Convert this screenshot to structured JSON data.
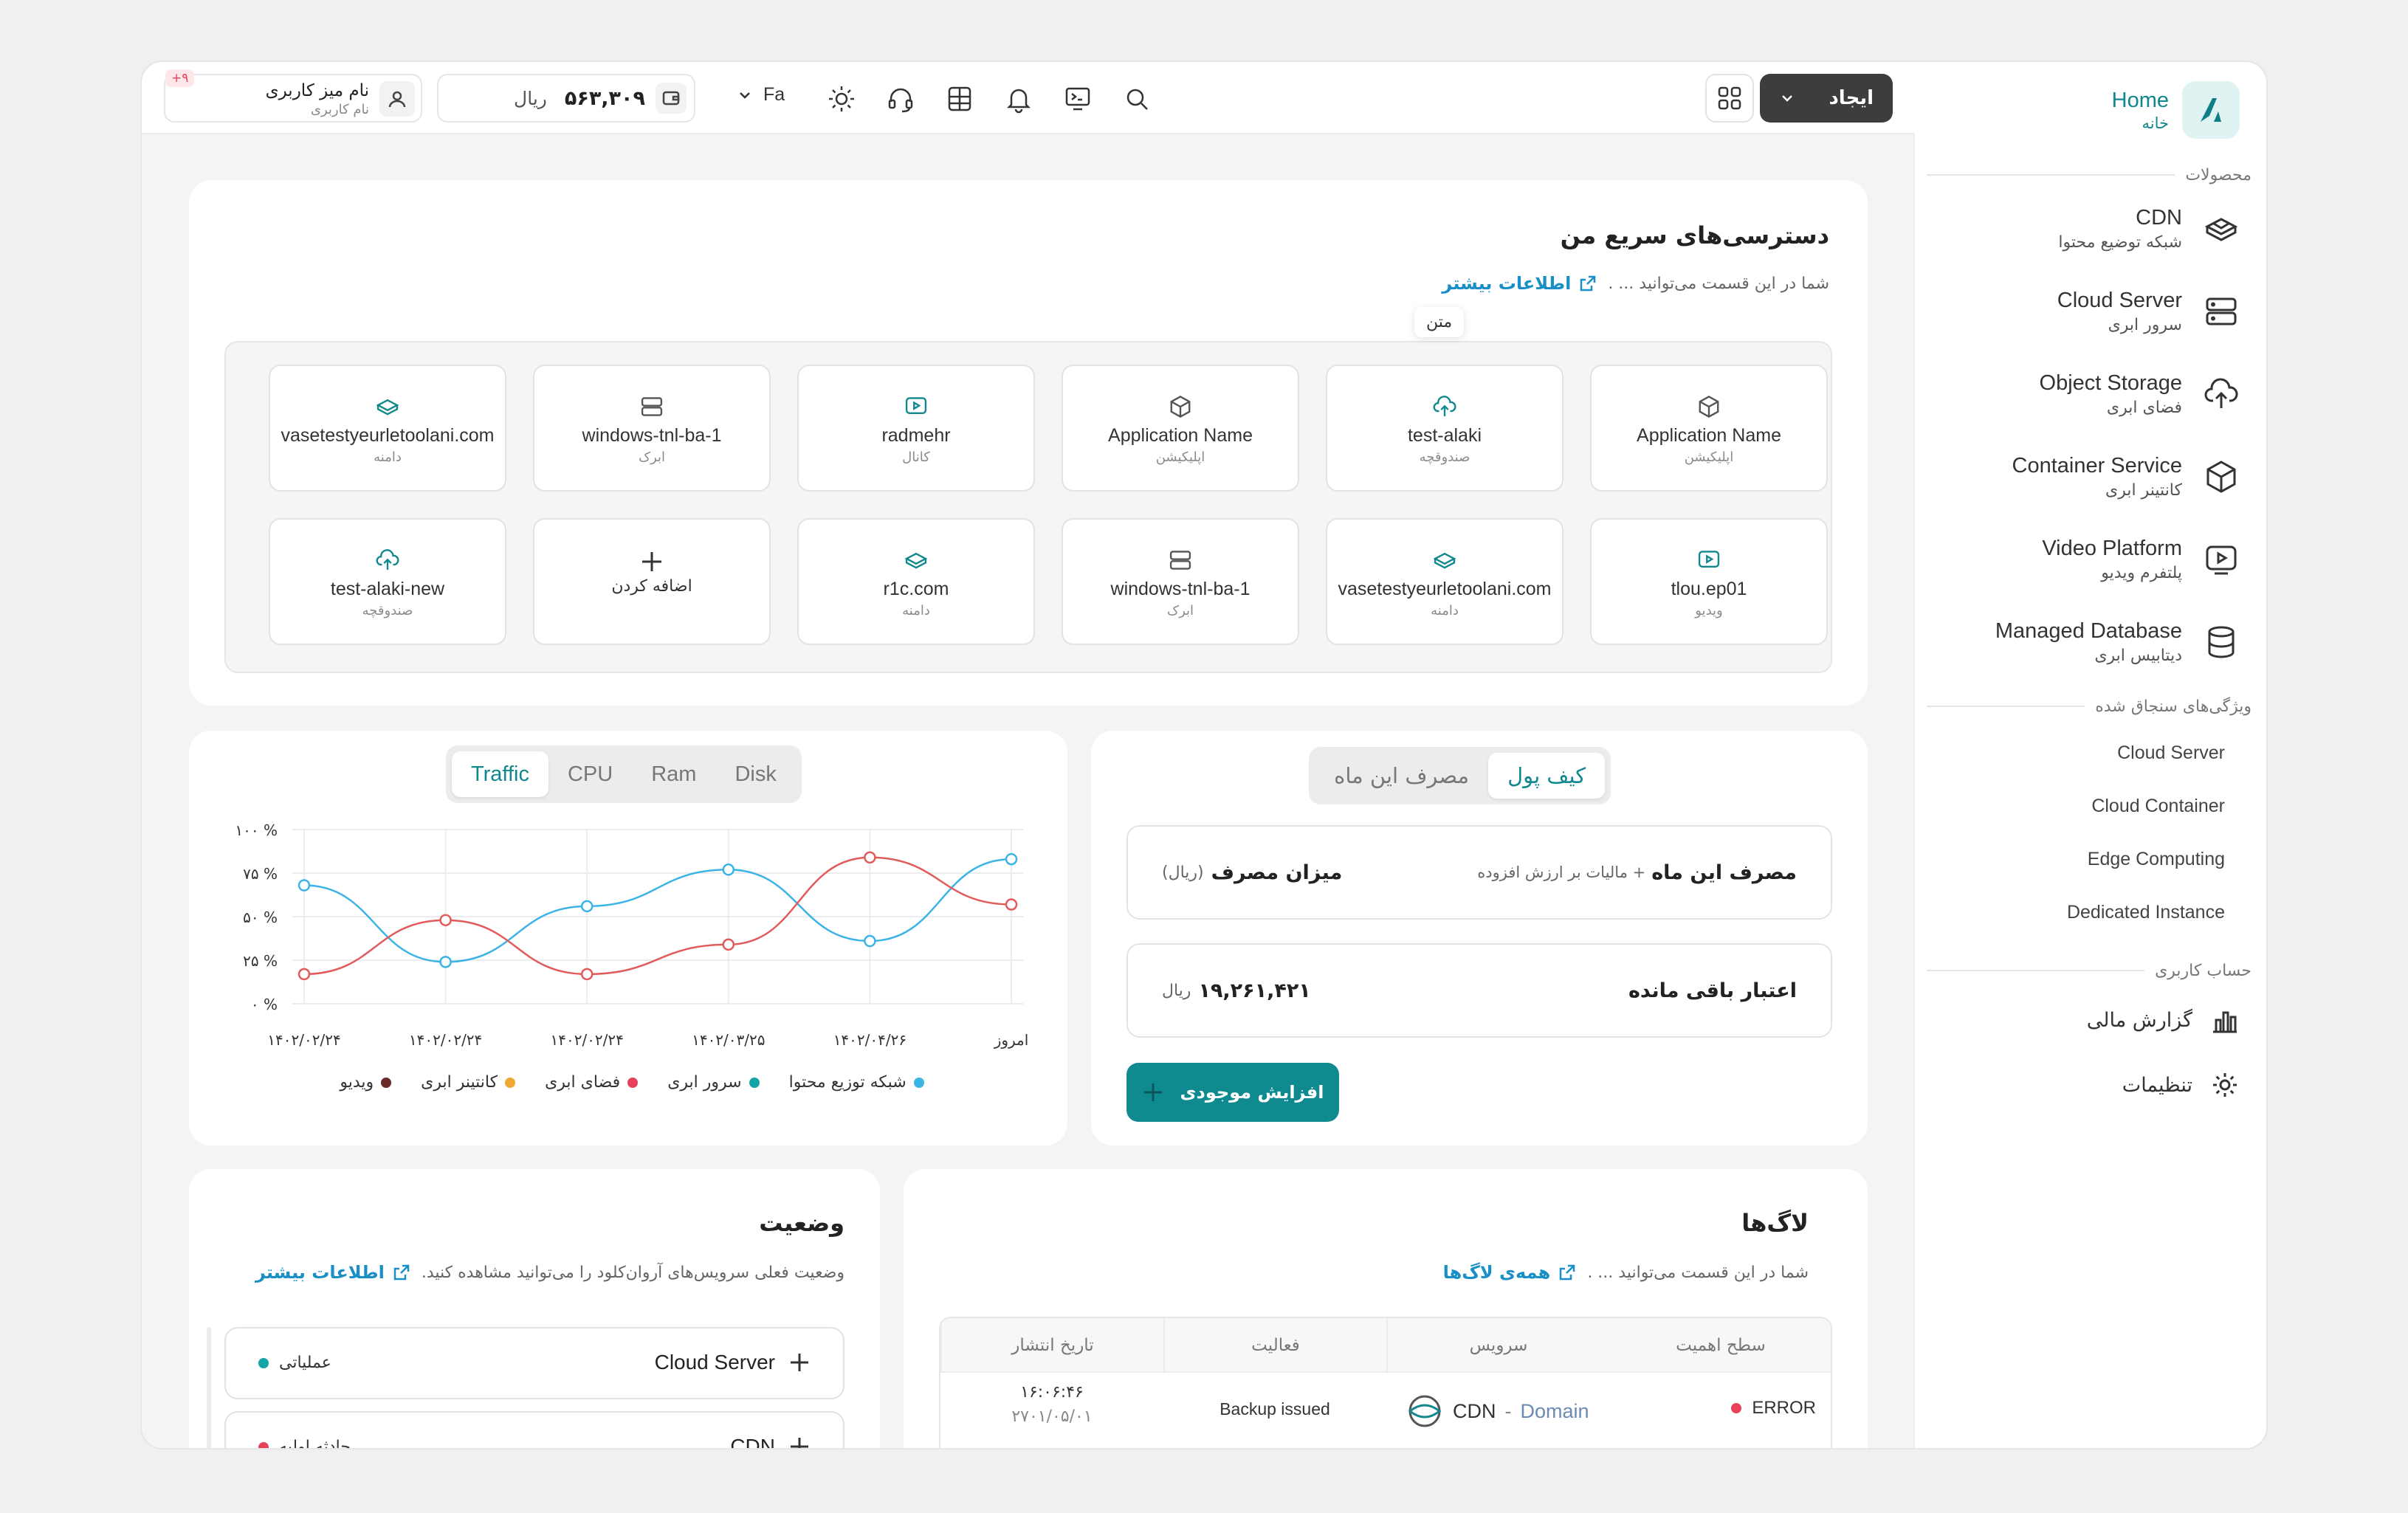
{
  "sidebar": {
    "logo_en": "Home",
    "logo_fa": "خانه",
    "products_label": "محصولات",
    "products": [
      {
        "en": "CDN",
        "fa": "شبکه توضیع محتوا",
        "icon": "cdn-icon"
      },
      {
        "en": "Cloud Server",
        "fa": "سرور ابری",
        "icon": "server-icon"
      },
      {
        "en": "Object Storage",
        "fa": "فضای ابری",
        "icon": "cloud-upload-icon"
      },
      {
        "en": "Container Service",
        "fa": "کانتینر ابری",
        "icon": "box-icon"
      },
      {
        "en": "Video Platform",
        "fa": "پلتفرم ویدیو",
        "icon": "video-icon"
      },
      {
        "en": "Managed Database",
        "fa": "دیتابیس ابری",
        "icon": "database-icon"
      }
    ],
    "features_label": "ویژگی‌های سنجاق شده",
    "features": [
      "Cloud Server",
      "Cloud Container",
      "Edge Computing",
      "Dedicated Instance"
    ],
    "account_label": "حساب کاربری",
    "account": [
      {
        "label": "گزارش مالی",
        "icon": "bar-chart-icon"
      },
      {
        "label": "تنظیمات",
        "icon": "gear-icon"
      }
    ]
  },
  "header": {
    "create_label": "ایجاد",
    "language": "Fa",
    "wallet_amount": "۵۶۳,۳۰۹",
    "wallet_unit": "ریال",
    "user_name": "نام میز کاربری",
    "user_sub": "نام کاربری",
    "badge": "+۹"
  },
  "quick_access": {
    "title": "دسترسی‌های سریع من",
    "desc": "شما در این قسمت می‌توانید ... .",
    "more": "اطلاعات بیشتر",
    "tooltip": "متن",
    "row1": [
      {
        "name": "Application Name",
        "sub": "اپلیکیشن",
        "icon": "box-icon"
      },
      {
        "name": "test-alaki",
        "sub": "صندوقچه",
        "icon": "cloud-upload-icon"
      },
      {
        "name": "Application Name",
        "sub": "اپلیکیشن",
        "icon": "box-icon"
      },
      {
        "name": "radmehr",
        "sub": "کانال",
        "icon": "video-icon"
      },
      {
        "name": "windows-tnl-ba-1",
        "sub": "ابرک",
        "icon": "server-icon"
      },
      {
        "name": "vasetestyeurletoolani.com",
        "sub": "دامنه",
        "icon": "cdn-icon"
      }
    ],
    "row2": [
      {
        "name": "tlou.ep01",
        "sub": "ویدیو",
        "icon": "video-icon"
      },
      {
        "name": "vasetestyeurletoolani.com",
        "sub": "دامنه",
        "icon": "cdn-icon"
      },
      {
        "name": "windows-tnl-ba-1",
        "sub": "ابرک",
        "icon": "server-icon"
      },
      {
        "name": "r1c.com",
        "sub": "دامنه",
        "icon": "cdn-icon"
      },
      {
        "name": "",
        "sub": "اضافه کردن",
        "icon": "plus-icon"
      },
      {
        "name": "test-alaki-new",
        "sub": "صندوقچه",
        "icon": "cloud-upload-icon"
      }
    ]
  },
  "wallet_card": {
    "tabs": [
      "کیف پول",
      "مصرف این ماه"
    ],
    "usage_title": "مصرف این ماه",
    "usage_note": "+ مالیات بر ارزش افزوده",
    "usage_amount_label": "میزان مصرف",
    "usage_amount_unit": "(ریال)",
    "credit_label": "اعتبار باقی مانده",
    "credit_value": "۱۹,۲۶۱,۴۲۱",
    "credit_unit": "ریال",
    "add_button": "افزایش موجودی"
  },
  "chart_card": {
    "tabs": [
      "Traffic",
      "CPU",
      "Ram",
      "Disk"
    ],
    "active_tab": "Traffic"
  },
  "chart_data": {
    "type": "line",
    "categories": [
      "۱۴۰۲/۰۲/۲۴",
      "۱۴۰۲/۰۲/۲۴",
      "۱۴۰۲/۰۲/۲۴",
      "۱۴۰۲/۰۳/۲۵",
      "۱۴۰۲/۰۴/۲۶",
      "امروز"
    ],
    "y_ticks": [
      "۰ %",
      "۲۵ %",
      "۵۰ %",
      "۷۵ %",
      "۱۰۰ %"
    ],
    "ylim": [
      0,
      100
    ],
    "series": [
      {
        "name": "شبکه توزیع محتوا",
        "color": "#3bb4e5",
        "values": [
          68,
          24,
          56,
          77,
          36,
          83
        ]
      },
      {
        "name": "سرور ابری",
        "color": "#e25b5b",
        "values": [
          17,
          48,
          17,
          34,
          84,
          57
        ]
      }
    ],
    "legend": [
      {
        "name": "شبکه توزیع محتوا",
        "color": "#3bb4e5"
      },
      {
        "name": "سرور ابری",
        "color": "#13a5a5"
      },
      {
        "name": "فضای ابری",
        "color": "#e8415b"
      },
      {
        "name": "کانتینر ابری",
        "color": "#f0a733"
      },
      {
        "name": "ویدیو",
        "color": "#6b2a2a"
      }
    ]
  },
  "logs": {
    "title": "لاگ‌ها",
    "desc": "شما در این قسمت می‌توانید ... .",
    "all": "همه‌ی لاگ‌ها",
    "columns": [
      "سطح اهمیت",
      "سرویس",
      "فعالیت",
      "تاریخ انتشار"
    ],
    "rows": [
      {
        "level": "ERROR",
        "service": "CDN",
        "service_sub": "Domain",
        "activity": "Backup issued",
        "time": "۱۶:۰۶:۴۶",
        "date": "۲۷۰۱/۰۵/۰۱"
      }
    ]
  },
  "status": {
    "title": "وضعیت",
    "desc": "وضعیت فعلی سرویس‌های آروان‌کلود را می‌توانید مشاهده کنید.",
    "more": "اطلاعات بیشتر",
    "items": [
      {
        "name": "Cloud Server",
        "state": "عملیاتی",
        "color": "#13a5a5"
      },
      {
        "name": "CDN",
        "state": "حادثه اولیه",
        "color": "#e8415b"
      }
    ]
  }
}
